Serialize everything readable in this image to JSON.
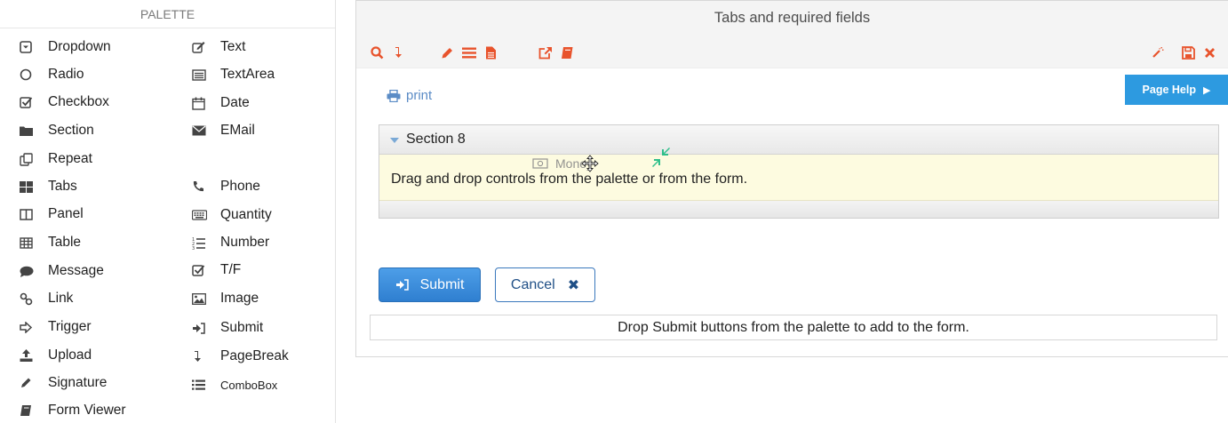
{
  "palette": {
    "header": "PALETTE",
    "col1": [
      {
        "label": "Dropdown",
        "icon": "dropdown-icon"
      },
      {
        "label": "Radio",
        "icon": "radio-icon"
      },
      {
        "label": "Checkbox",
        "icon": "checkbox-icon"
      },
      {
        "label": "Section",
        "icon": "folder-icon"
      },
      {
        "label": "Repeat",
        "icon": "repeat-icon"
      },
      {
        "label": "Tabs",
        "icon": "tabs-icon"
      },
      {
        "label": "Panel",
        "icon": "panel-icon"
      },
      {
        "label": "Table",
        "icon": "table-icon"
      },
      {
        "label": "Message",
        "icon": "message-icon"
      },
      {
        "label": "Link",
        "icon": "link-icon"
      },
      {
        "label": "Trigger",
        "icon": "trigger-icon"
      },
      {
        "label": "Upload",
        "icon": "upload-icon"
      },
      {
        "label": "Signature",
        "icon": "pencil-icon"
      },
      {
        "label": "Form Viewer",
        "icon": "book-icon"
      }
    ],
    "col2": [
      {
        "label": "Text",
        "icon": "edit-icon"
      },
      {
        "label": "TextArea",
        "icon": "textarea-icon"
      },
      {
        "label": "Date",
        "icon": "calendar-icon"
      },
      {
        "label": "EMail",
        "icon": "envelope-icon"
      },
      {
        "label": "Phone",
        "icon": "phone-icon"
      },
      {
        "label": "Quantity",
        "icon": "keyboard-icon"
      },
      {
        "label": "Number",
        "icon": "ordered-list-icon"
      },
      {
        "label": "T/F",
        "icon": "checkbox-icon"
      },
      {
        "label": "Image",
        "icon": "image-icon"
      },
      {
        "label": "Submit",
        "icon": "sign-in-icon"
      },
      {
        "label": "PageBreak",
        "icon": "pagebreak-icon"
      },
      {
        "label": "ComboBox",
        "icon": "list-icon"
      }
    ]
  },
  "form": {
    "title": "Tabs and required fields",
    "print_label": "print",
    "page_help_label": "Page Help",
    "section": {
      "title": "Section 8",
      "drop_text": "Drag and drop controls from the palette or from the form.",
      "drag_ghost_label": "Money"
    },
    "submit_label": "Submit",
    "cancel_label": "Cancel",
    "submit_drop_text": "Drop Submit buttons from the palette to add to the form."
  },
  "colors": {
    "toolbar_icon": "#e8532c",
    "accent_blue": "#2d9ae0",
    "section_body_bg": "#fdfbe0",
    "link_blue": "#5b8cc6"
  }
}
